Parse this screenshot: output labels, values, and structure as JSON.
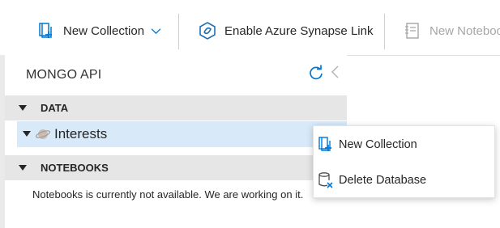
{
  "toolbar": {
    "new_collection_label": "New Collection",
    "enable_synapse_label": "Enable Azure Synapse Link",
    "new_notebook_label": "New Notebook"
  },
  "panel": {
    "header": "MONGO API",
    "data_section": "DATA",
    "database_name": "Interests",
    "notebooks_section": "NOTEBOOKS",
    "notebooks_notice": "Notebooks is currently not available. We are working on it."
  },
  "context_menu": {
    "items": [
      {
        "label": "New Collection",
        "icon": "new-collection-icon"
      },
      {
        "label": "Delete Database",
        "icon": "delete-database-icon"
      }
    ]
  },
  "colors": {
    "accent": "#0078d4",
    "selected_row": "#d8eafa",
    "section_bg": "#e6e6e6",
    "delete_icon": "#0078d4"
  }
}
